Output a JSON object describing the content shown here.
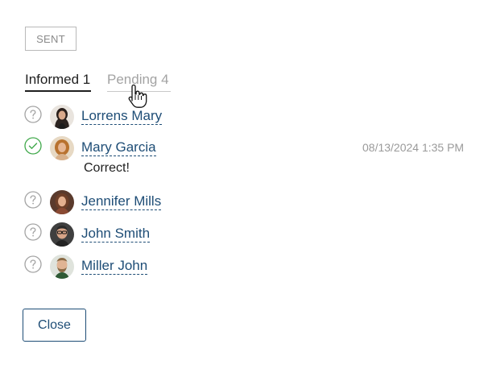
{
  "status_badge": "SENT",
  "tabs": [
    {
      "label": "Informed 1",
      "active": true
    },
    {
      "label": "Pending 4",
      "active": false
    }
  ],
  "recipients": [
    {
      "name": "Lorrens Mary",
      "status": "pending",
      "status_icon": "question-circle-icon"
    },
    {
      "name": "Mary Garcia",
      "status": "informed",
      "status_icon": "check-circle-icon",
      "timestamp": "08/13/2024 1:35 PM",
      "comment": "Correct!"
    },
    {
      "name": "Jennifer Mills",
      "status": "pending",
      "status_icon": "question-circle-icon"
    },
    {
      "name": "John Smith",
      "status": "pending",
      "status_icon": "question-circle-icon"
    },
    {
      "name": "Miller John",
      "status": "pending",
      "status_icon": "question-circle-icon"
    }
  ],
  "close_label": "Close",
  "colors": {
    "link": "#1e4d76",
    "informed": "#3fa84a",
    "pending": "#a3a3a3",
    "muted_text": "#9a9a9a"
  }
}
